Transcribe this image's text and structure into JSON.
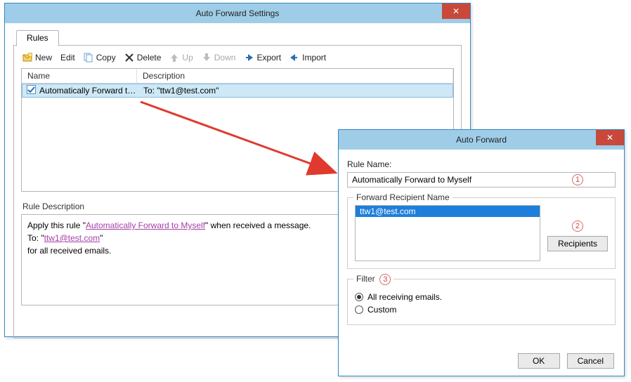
{
  "win1": {
    "title": "Auto Forward Settings",
    "tab": "Rules",
    "toolbar": {
      "new": "New",
      "edit": "Edit",
      "copy": "Copy",
      "delete": "Delete",
      "up": "Up",
      "down": "Down",
      "export": "Export",
      "import": "Import"
    },
    "columns": {
      "name": "Name",
      "desc": "Description"
    },
    "rule": {
      "name": "Automatically Forward to...",
      "desc": "To: \"ttw1@test.com\""
    },
    "ruledesc_label": "Rule Description",
    "ruledesc": {
      "line1a": "Apply this rule \"",
      "rulename": "Automatically Forward to Myself",
      "line1b": "\" when received a message.",
      "line2a": "To: \"",
      "email": "ttw1@test.com",
      "line2b": "\"",
      "line3": "for all received emails."
    }
  },
  "win2": {
    "title": "Auto Forward",
    "rulename_label": "Rule Name:",
    "rulename_value": "Automatically Forward to Myself",
    "recip_legend": "Forward Recipient Name",
    "recip_value": "ttw1@test.com",
    "recip_button": "Recipients",
    "filter_legend": "Filter",
    "filter_all": "All receiving emails.",
    "filter_custom": "Custom",
    "ok": "OK",
    "cancel": "Cancel"
  },
  "callouts": {
    "c1": "1",
    "c2": "2",
    "c3": "3"
  }
}
